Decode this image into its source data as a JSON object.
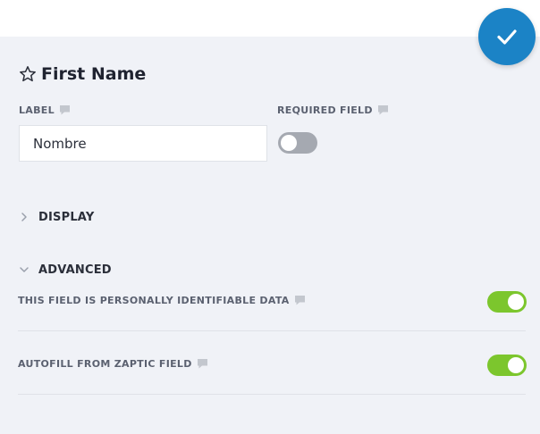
{
  "header": {
    "save_icon": "checkmark-icon",
    "accent_color": "#1b83c6"
  },
  "field": {
    "title": "First Name",
    "title_icon": "star-outline-icon"
  },
  "label_field": {
    "label": "LABEL",
    "value": "Nombre"
  },
  "required_field": {
    "label": "REQUIRED FIELD",
    "enabled": false
  },
  "sections": {
    "display": {
      "label": "DISPLAY",
      "expanded": false
    },
    "advanced": {
      "label": "ADVANCED",
      "expanded": true
    }
  },
  "advanced": {
    "pii": {
      "label": "THIS FIELD IS PERSONALLY IDENTIFIABLE DATA",
      "enabled": true
    },
    "autofill": {
      "label": "AUTOFILL FROM ZAPTIC FIELD",
      "enabled": true
    }
  },
  "colors": {
    "toggle_on": "#7cc62d",
    "toggle_off": "#a5a9b1"
  }
}
